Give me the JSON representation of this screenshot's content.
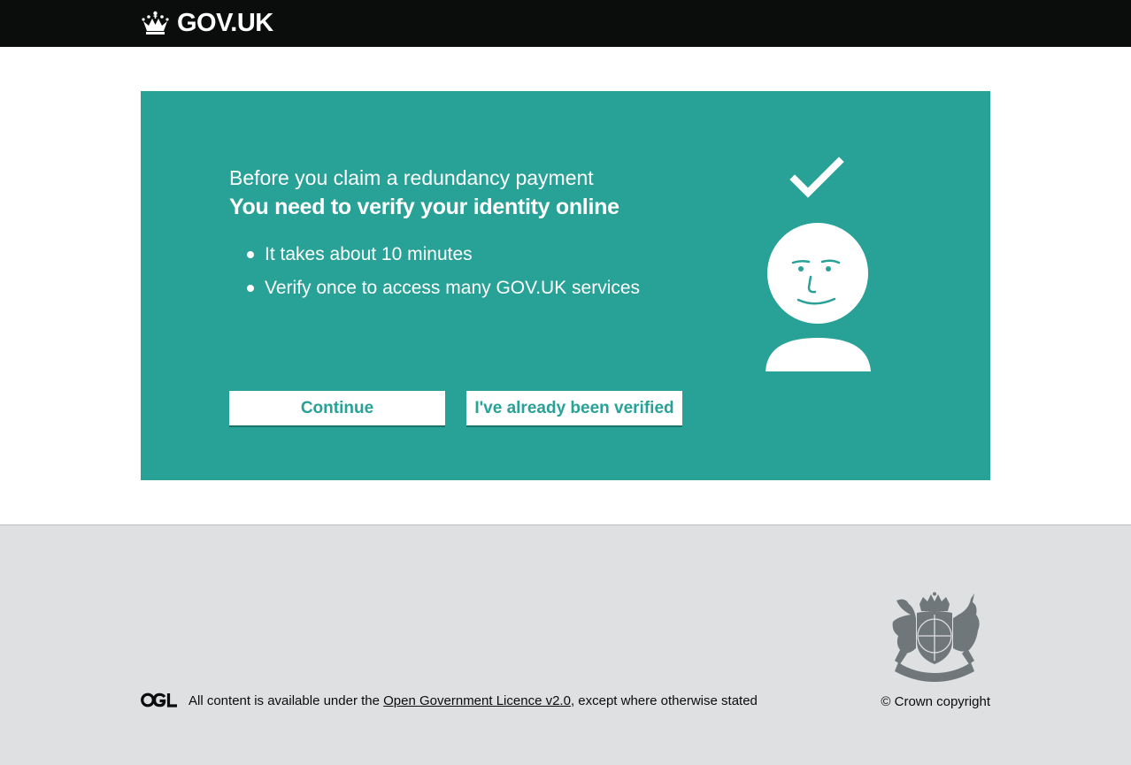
{
  "header": {
    "brand": "GOV.UK",
    "crown_icon": "crown-icon"
  },
  "panel": {
    "background_color": "#28a197",
    "lead": "Before you claim a redundancy payment",
    "heading": "You need to verify your identity online",
    "bullets": [
      "It takes about 10 minutes",
      "Verify once to access many GOV.UK services"
    ],
    "illustration_icons": [
      "check-icon",
      "person-icon"
    ],
    "buttons": {
      "continue": "Continue",
      "already_verified": "I've already been verified"
    }
  },
  "footer": {
    "background_color": "#dee0e2",
    "ogl_icon": "ogl-logo",
    "licence_prefix": "All content is available under the ",
    "licence_link": "Open Government Licence v2.0",
    "licence_suffix": ", except where otherwise stated",
    "crest_icon": "royal-coat-of-arms-icon",
    "copyright": "© Crown copyright"
  }
}
